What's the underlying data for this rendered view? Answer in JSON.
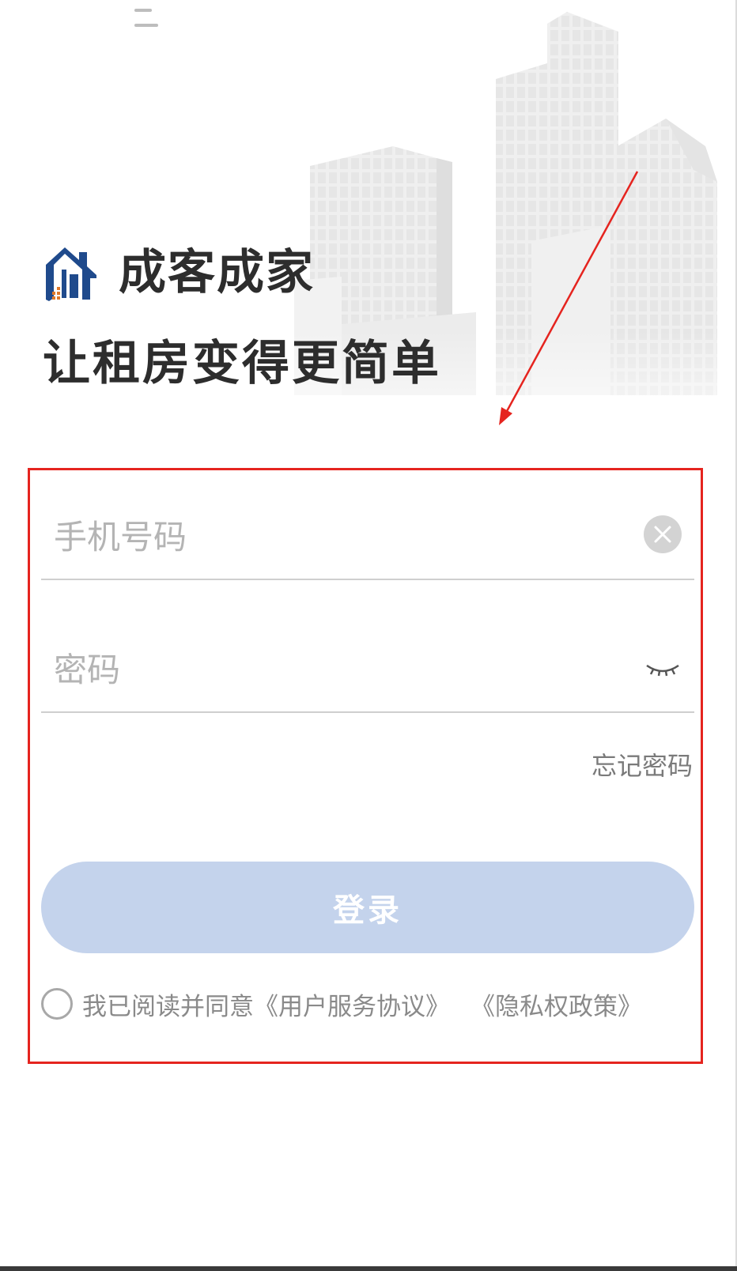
{
  "brand": {
    "name": "成客成家",
    "logo_icon": "house-logo-icon"
  },
  "slogan": "让租房变得更简单",
  "form": {
    "phone_placeholder": "手机号码",
    "password_placeholder": "密码",
    "clear_icon": "clear-circle-icon",
    "eye_icon": "eye-closed-icon",
    "forgot_label": "忘记密码",
    "login_label": "登录"
  },
  "agreement": {
    "prefix": "我已阅读并同意",
    "user_agreement": "《用户服务协议》",
    "privacy_policy": "《隐私权政策》"
  },
  "colors": {
    "login_button": "#c4d3ec",
    "annotation": "#e5241f",
    "logo_blue": "#1f4a8c",
    "logo_orange": "#e0792a"
  }
}
